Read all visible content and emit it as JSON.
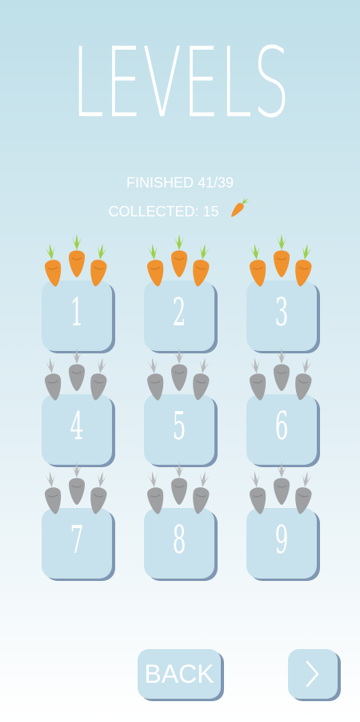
{
  "header": {
    "title": "LEVELS"
  },
  "stats": {
    "finished": "FINISHED 41/39",
    "collected": "COLLECTED: 15"
  },
  "levels": [
    {
      "label": "1",
      "carrots_collected": 3,
      "carrots_total": 3
    },
    {
      "label": "2",
      "carrots_collected": 3,
      "carrots_total": 3
    },
    {
      "label": "3",
      "carrots_collected": 3,
      "carrots_total": 3
    },
    {
      "label": "4",
      "carrots_collected": 0,
      "carrots_total": 3
    },
    {
      "label": "5",
      "carrots_collected": 0,
      "carrots_total": 3
    },
    {
      "label": "6",
      "carrots_collected": 0,
      "carrots_total": 3
    },
    {
      "label": "7",
      "carrots_collected": 0,
      "carrots_total": 3
    },
    {
      "label": "8",
      "carrots_collected": 0,
      "carrots_total": 3
    },
    {
      "label": "9",
      "carrots_collected": 0,
      "carrots_total": 3
    }
  ],
  "footer": {
    "back_label": "BACK",
    "next_icon": "chevron-right-icon"
  },
  "colors": {
    "carrot_collected": "#f0922e",
    "leaf_collected": "#9ccf4a",
    "carrot_locked": "#9ea0a2",
    "leaf_locked": "#b8babb",
    "tile": "#c7e2ec",
    "tile_shadow": "#7f97b2"
  }
}
